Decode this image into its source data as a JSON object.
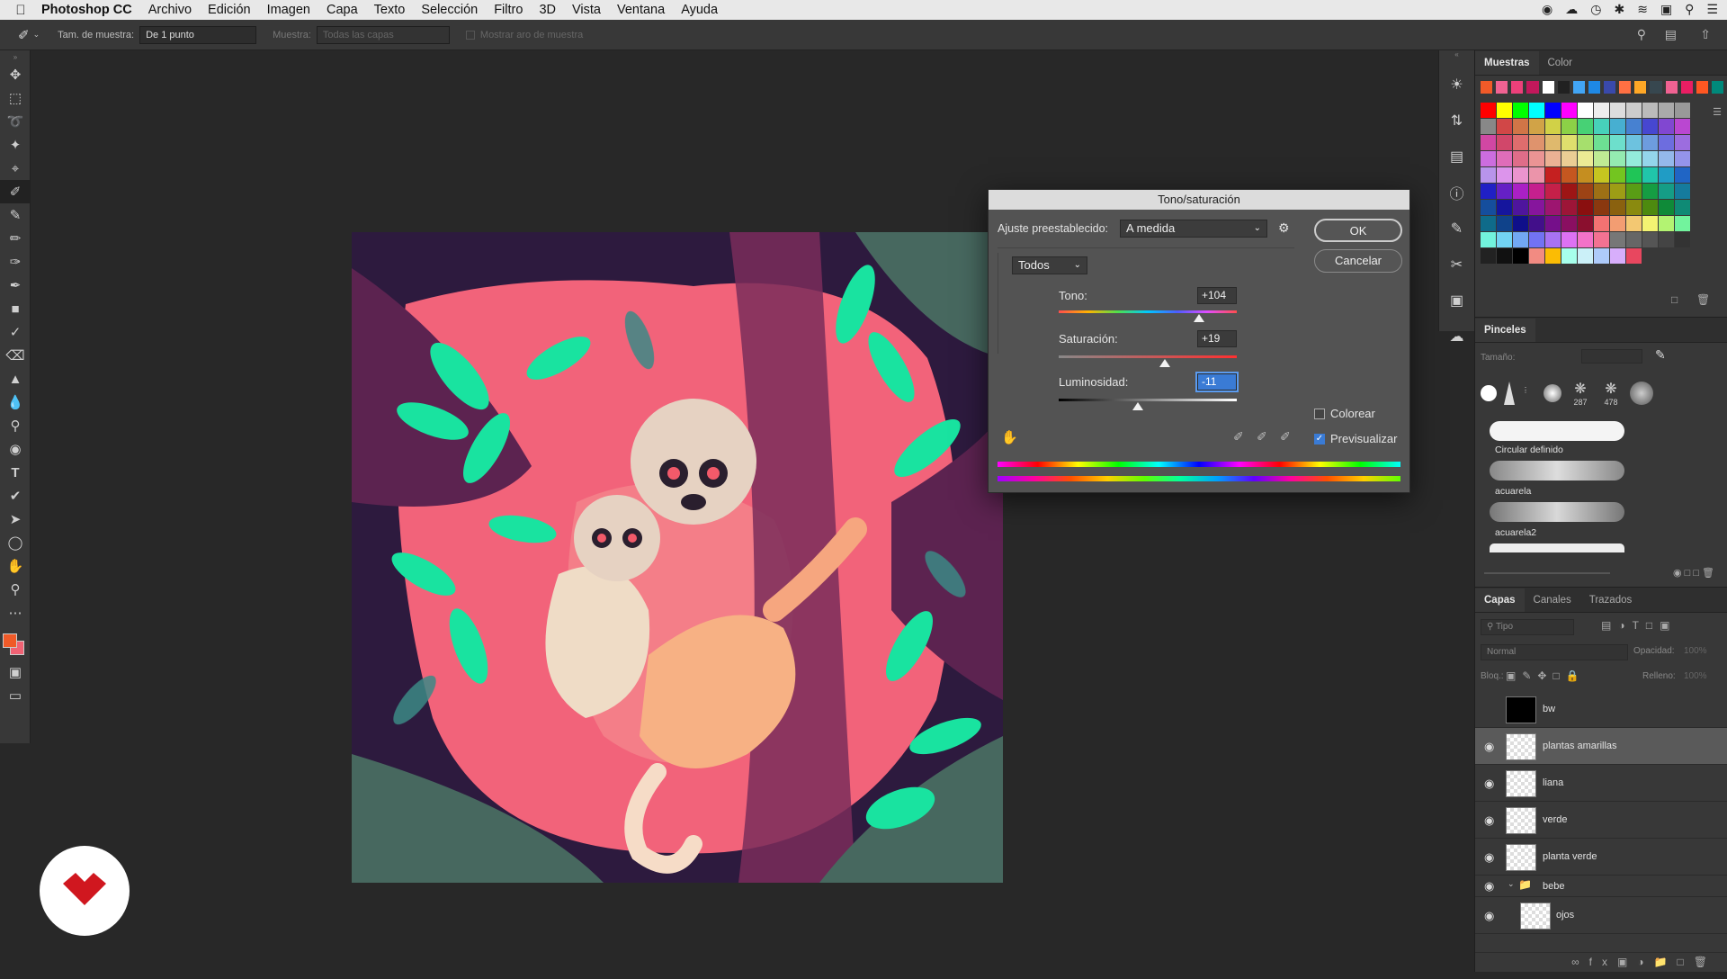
{
  "menubar": {
    "app": "Photoshop CC",
    "items": [
      "Archivo",
      "Edición",
      "Imagen",
      "Capa",
      "Texto",
      "Selección",
      "Filtro",
      "3D",
      "Vista",
      "Ventana",
      "Ayuda"
    ]
  },
  "options": {
    "sample_size_label": "Tam. de muestra:",
    "sample_size_value": "De 1 punto",
    "sample_label": "Muestra:",
    "sample_value": "Todas las capas",
    "show_ring_label": "Mostrar aro de muestra"
  },
  "dialog": {
    "title": "Tono/saturación",
    "preset_label": "Ajuste preestablecido:",
    "preset_value": "A medida",
    "channel_value": "Todos",
    "ok": "OK",
    "cancel": "Cancelar",
    "hue_label": "Tono:",
    "hue_value": "+104",
    "hue_slider": 0.79,
    "saturation_label": "Saturación:",
    "saturation_value": "+19",
    "saturation_slider": 0.595,
    "lightness_label": "Luminosidad:",
    "lightness_value": "-11",
    "lightness_slider": 0.445,
    "colorize_label": "Colorear",
    "colorize_checked": false,
    "preview_label": "Previsualizar",
    "preview_checked": true
  },
  "swatches_panel": {
    "tabs": [
      "Muestras",
      "Color"
    ],
    "recent": [
      "#f05a28",
      "#f06292",
      "#ec407a",
      "#c2185b",
      "#ffffff",
      "#212121",
      "#42a5f5",
      "#1e88e5",
      "#3949ab",
      "#ff7043",
      "#ffa726",
      "#37474f",
      "#f06292",
      "#e91e63",
      "#ff5722",
      "#00897b"
    ]
  },
  "brushes_panel": {
    "title": "Pinceles",
    "size_label": "Tamaño:",
    "numbers": [
      "287",
      "478"
    ],
    "brushes": [
      "Circular definido",
      "acuarela",
      "acuarela2"
    ]
  },
  "layers_panel": {
    "tabs": [
      "Capas",
      "Canales",
      "Trazados"
    ],
    "filter_placeholder": "Tipo",
    "blend_mode": "Normal",
    "opacity_label": "Opacidad:",
    "opacity_value": "100%",
    "lock_label": "Bloq.:",
    "fill_label": "Relleno:",
    "fill_value": "100%",
    "layers": [
      {
        "name": "bw",
        "visible": false,
        "selected": false
      },
      {
        "name": "plantas amarillas",
        "visible": true,
        "selected": true
      },
      {
        "name": "liana",
        "visible": true,
        "selected": false
      },
      {
        "name": "verde",
        "visible": true,
        "selected": false
      },
      {
        "name": "planta verde",
        "visible": true,
        "selected": false
      },
      {
        "name": "bebe",
        "visible": true,
        "selected": false,
        "group": true
      },
      {
        "name": "ojos",
        "visible": true,
        "selected": false
      }
    ]
  },
  "colors": {
    "foreground": "#f05a28",
    "background": "#f06274",
    "accent": "#3a7bd5"
  }
}
